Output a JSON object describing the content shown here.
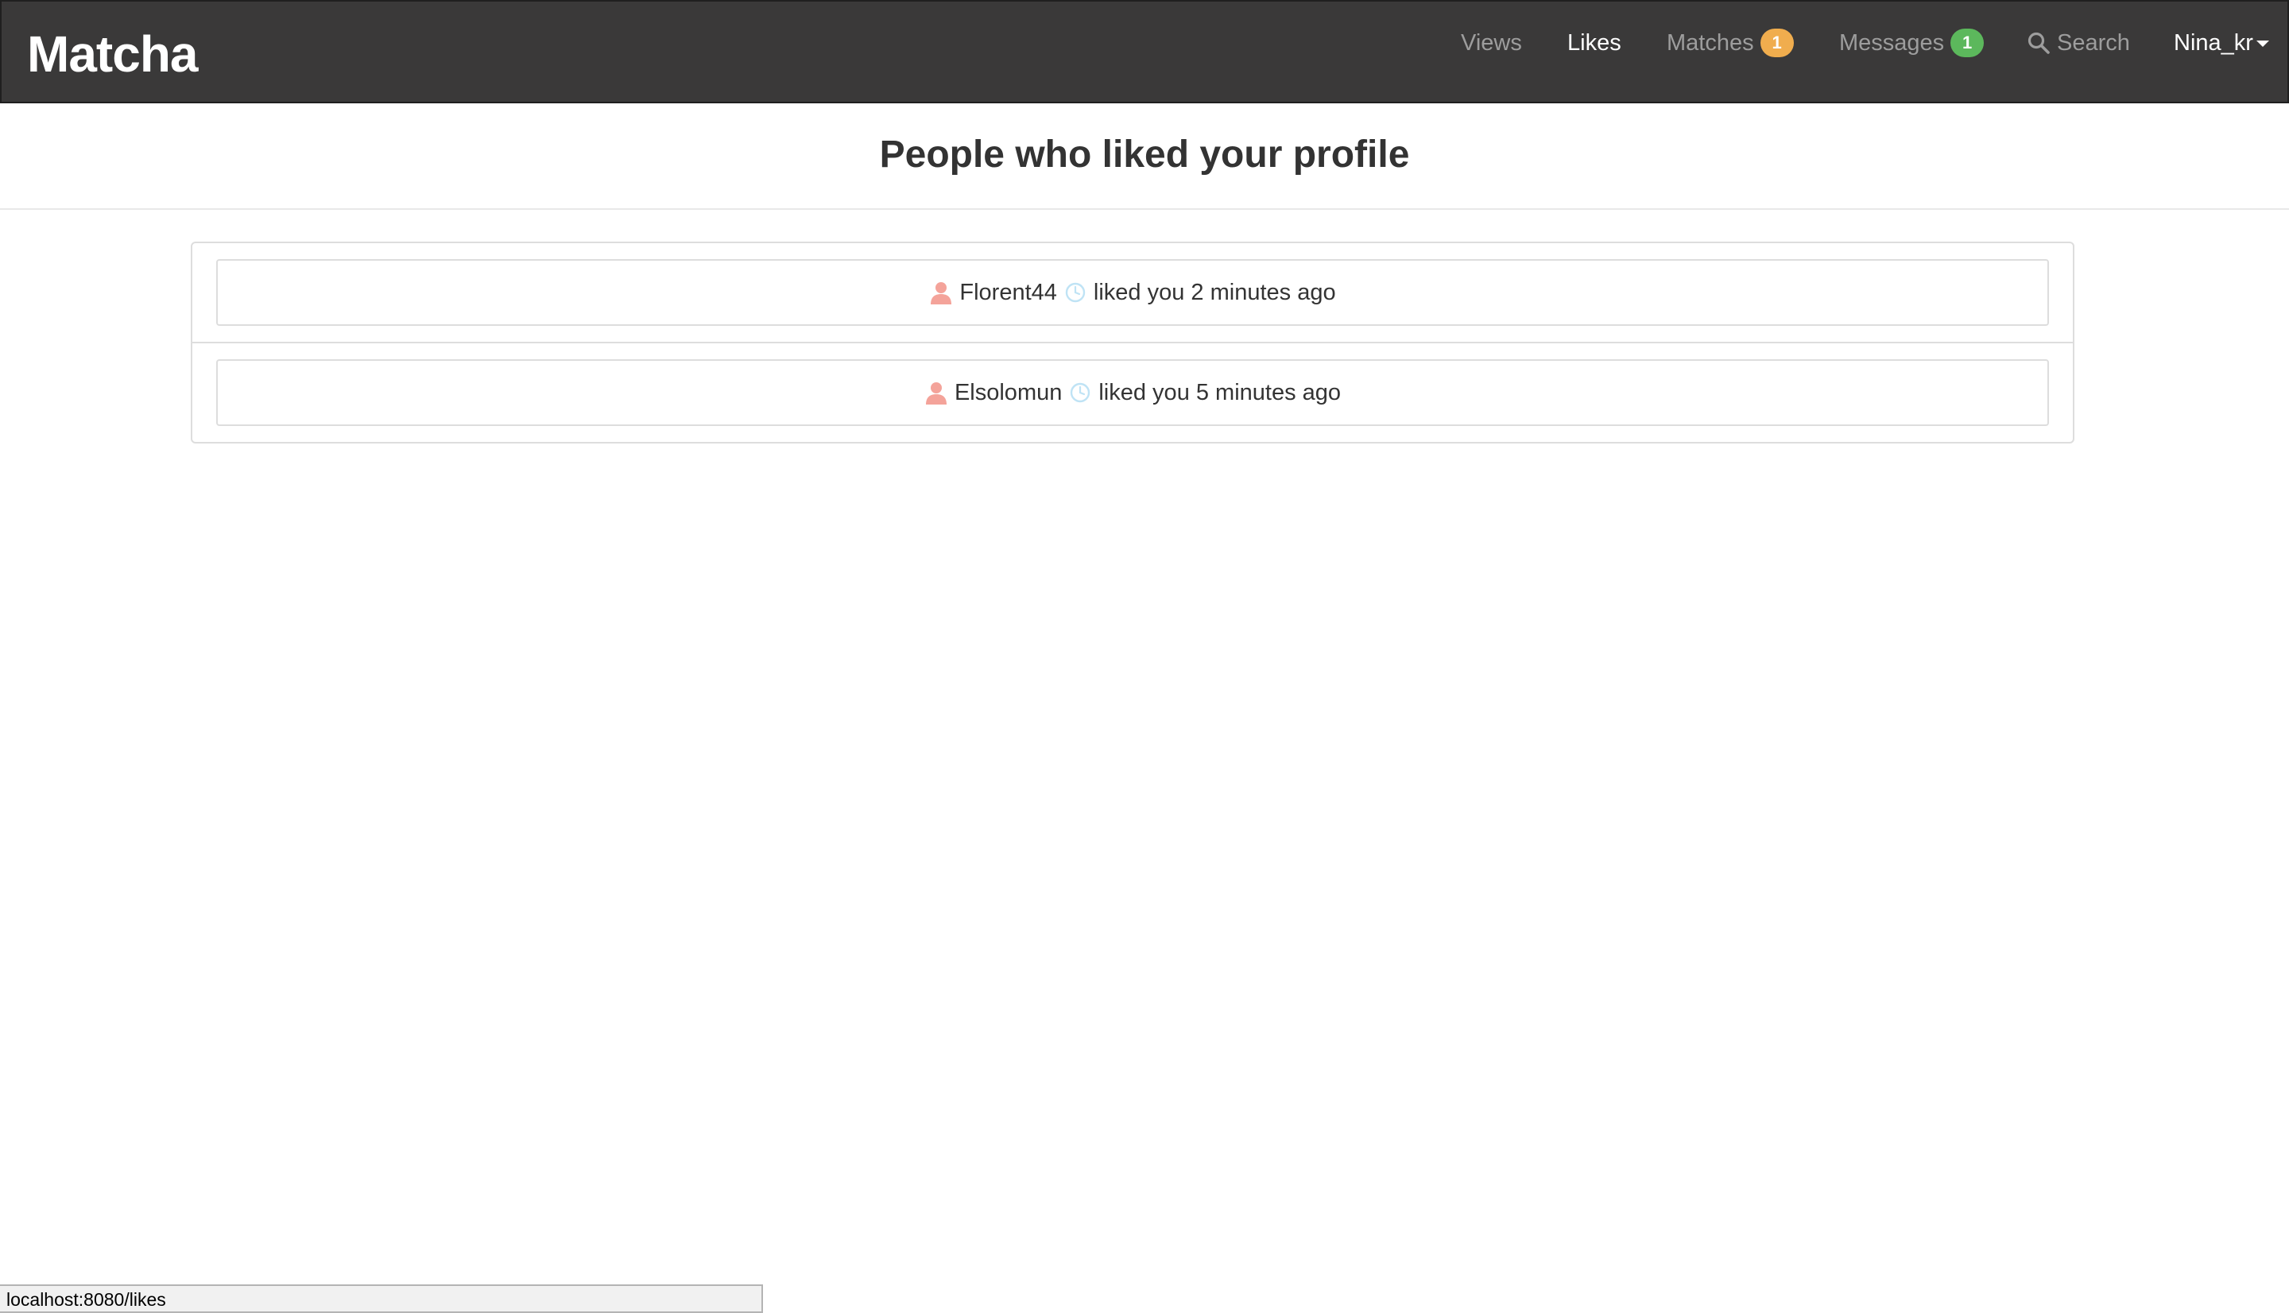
{
  "navbar": {
    "brand": "Matcha",
    "items": [
      {
        "label": "Views",
        "active": false
      },
      {
        "label": "Likes",
        "active": true
      },
      {
        "label": "Matches",
        "badge": "1",
        "badge_color": "#f0ad4e"
      },
      {
        "label": "Messages",
        "badge": "1",
        "badge_color": "#5cb85c"
      },
      {
        "label": "Search",
        "icon": "search-icon"
      },
      {
        "label": "Nina_kr",
        "icon": "caret-down-icon"
      }
    ]
  },
  "page": {
    "title": "People who liked your profile"
  },
  "likes": [
    {
      "username": "Florent44",
      "text": "liked you 2 minutes ago",
      "icon": "user-icon",
      "time_icon": "clock-icon"
    },
    {
      "username": "Elsolomun",
      "text": "liked you 5 minutes ago",
      "icon": "user-icon",
      "time_icon": "clock-icon"
    }
  ],
  "statusbar": {
    "url": "localhost:8080/likes"
  },
  "colors": {
    "navbar_bg": "#3a3939",
    "user_icon": "#f4a39a",
    "clock_icon": "#bfe3f5"
  }
}
